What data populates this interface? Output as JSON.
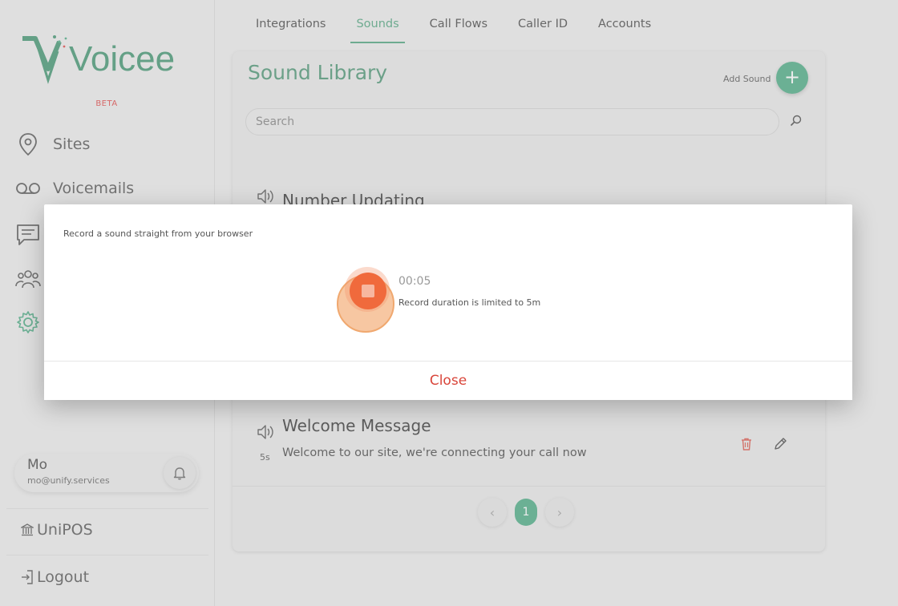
{
  "brand": {
    "logo_text": "Voicee",
    "beta": "BETA",
    "accent": "#3aa478",
    "brand_green": "#2e8a63"
  },
  "sidebar": {
    "items": [
      {
        "label": "Sites",
        "icon": "location-pin-icon"
      },
      {
        "label": "Voicemails",
        "icon": "voicemail-icon"
      },
      {
        "label": "",
        "icon": "chat-icon"
      },
      {
        "label": "",
        "icon": "users-icon"
      },
      {
        "label": "",
        "icon": "gear-icon"
      }
    ],
    "user": {
      "name": "Mo",
      "email": "mo@unify.services"
    },
    "bottom": [
      {
        "label": "UniPOS",
        "icon": "bank-icon"
      },
      {
        "label": "Logout",
        "icon": "logout-icon"
      }
    ]
  },
  "tabs": [
    {
      "label": "Integrations",
      "active": false
    },
    {
      "label": "Sounds",
      "active": true
    },
    {
      "label": "Call Flows",
      "active": false
    },
    {
      "label": "Caller ID",
      "active": false
    },
    {
      "label": "Accounts",
      "active": false
    }
  ],
  "library": {
    "title": "Sound Library",
    "add_label": "Add Sound",
    "add_symbol": "+",
    "search_placeholder": "Search",
    "sounds": [
      {
        "title": "Number Updating",
        "description": "",
        "duration": ""
      },
      {
        "title": "Welcome Message",
        "description": "Welcome to our site, we're connecting your call now",
        "duration": "5s"
      }
    ]
  },
  "pagination": {
    "prev": "‹",
    "current": "1",
    "next": "›"
  },
  "modal": {
    "description": "Record a sound straight from your browser",
    "timer": "00:05",
    "limit": "Record duration is limited to 5m",
    "close_label": "Close"
  }
}
